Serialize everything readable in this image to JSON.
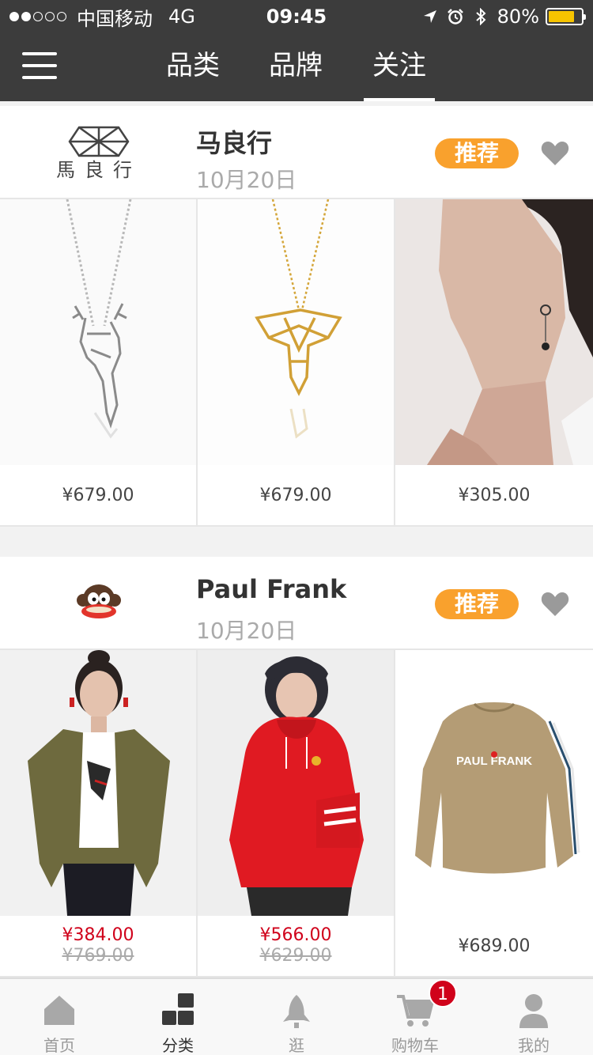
{
  "status_bar": {
    "carrier": "中国移动",
    "network": "4G",
    "time": "09:45",
    "battery": "80%",
    "battery_level": 0.8
  },
  "nav": {
    "tabs": [
      {
        "label": "品类"
      },
      {
        "label": "品牌"
      },
      {
        "label": "关注"
      }
    ],
    "active_tab": "关注"
  },
  "brands": [
    {
      "logo_text": "馬良行",
      "name": "马良行",
      "date": "10月20日",
      "recommend_label": "推荐",
      "products": [
        {
          "price": "¥679.00"
        },
        {
          "price": "¥679.00"
        },
        {
          "price": "¥305.00"
        }
      ]
    },
    {
      "name": "Paul Frank",
      "date": "10月20日",
      "recommend_label": "推荐",
      "products": [
        {
          "sale_price": "¥384.00",
          "old_price": "¥769.00"
        },
        {
          "sale_price": "¥566.00",
          "old_price": "¥629.00"
        },
        {
          "price": "¥689.00",
          "sweater_text": "PAUL FRANK"
        }
      ]
    }
  ],
  "tab_bar": {
    "items": [
      {
        "label": "首页"
      },
      {
        "label": "分类"
      },
      {
        "label": "逛"
      },
      {
        "label": "购物车"
      },
      {
        "label": "我的"
      }
    ],
    "active": "分类",
    "cart_badge": "1"
  },
  "colors": {
    "header_bg": "#3c3c3c",
    "recommend_bg": "#f9a12d",
    "sale_price": "#d0021b",
    "battery": "#f7c400"
  }
}
